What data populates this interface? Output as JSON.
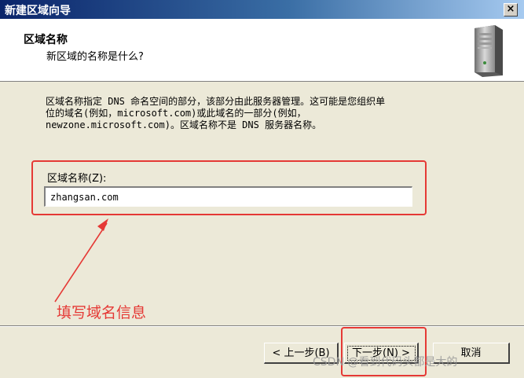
{
  "window": {
    "title": "新建区域向导",
    "close_label": "×"
  },
  "header": {
    "title": "区域名称",
    "subtitle": "新区域的名称是什么?",
    "icon": "server-icon"
  },
  "description": {
    "line1": "区域名称指定 DNS 命名空间的部分，该部分由此服务器管理。这可能是您组织单",
    "line2": "位的域名(例如，microsoft.com)或此域名的一部分(例如，",
    "line3": "newzone.microsoft.com)。区域名称不是 DNS 服务器名称。"
  },
  "zone_field": {
    "label": "区域名称(Z):",
    "value": "zhangsan.com"
  },
  "annotation": {
    "text": "填写域名信息",
    "color": "#e53935"
  },
  "buttons": {
    "back": "< 上一步(B)",
    "next": "下一步(N) >",
    "cancel": "取消"
  },
  "watermark": "CSDN @看到代码头都是大的"
}
